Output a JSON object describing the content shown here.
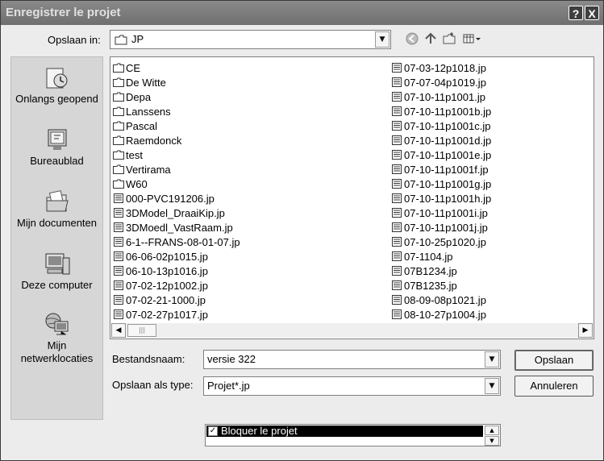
{
  "title": "Enregistrer le projet",
  "title_buttons": {
    "help": "?",
    "close": "X"
  },
  "save_in": {
    "label": "Opslaan in:",
    "value": "JP"
  },
  "places": [
    {
      "label": "Onlangs geopend",
      "icon": "recent-icon"
    },
    {
      "label": "Bureaublad",
      "icon": "desktop-icon"
    },
    {
      "label": "Mijn documenten",
      "icon": "documents-icon"
    },
    {
      "label": "Deze computer",
      "icon": "computer-icon"
    },
    {
      "label": "Mijn netwerklocaties",
      "icon": "network-icon"
    }
  ],
  "files_col1": [
    {
      "name": "CE",
      "type": "folder"
    },
    {
      "name": "De Witte",
      "type": "folder"
    },
    {
      "name": "Depa",
      "type": "folder"
    },
    {
      "name": "Lanssens",
      "type": "folder"
    },
    {
      "name": "Pascal",
      "type": "folder"
    },
    {
      "name": "Raemdonck",
      "type": "folder"
    },
    {
      "name": "test",
      "type": "folder"
    },
    {
      "name": "Vertirama",
      "type": "folder"
    },
    {
      "name": "W60",
      "type": "folder"
    },
    {
      "name": "000-PVC191206.jp",
      "type": "file"
    },
    {
      "name": "3DModel_DraaiKip.jp",
      "type": "file"
    },
    {
      "name": "3DMoedl_VastRaam.jp",
      "type": "file"
    },
    {
      "name": "6-1--FRANS-08-01-07.jp",
      "type": "file"
    },
    {
      "name": "06-06-02p1015.jp",
      "type": "file"
    },
    {
      "name": "06-10-13p1016.jp",
      "type": "file"
    },
    {
      "name": "07-02-12p1002.jp",
      "type": "file"
    },
    {
      "name": "07-02-21-1000.jp",
      "type": "file"
    },
    {
      "name": "07-02-27p1017.jp",
      "type": "file"
    }
  ],
  "files_col2": [
    {
      "name": "07-03-12p1018.jp",
      "type": "file"
    },
    {
      "name": "07-07-04p1019.jp",
      "type": "file"
    },
    {
      "name": "07-10-11p1001.jp",
      "type": "file"
    },
    {
      "name": "07-10-11p1001b.jp",
      "type": "file"
    },
    {
      "name": "07-10-11p1001c.jp",
      "type": "file"
    },
    {
      "name": "07-10-11p1001d.jp",
      "type": "file"
    },
    {
      "name": "07-10-11p1001e.jp",
      "type": "file"
    },
    {
      "name": "07-10-11p1001f.jp",
      "type": "file"
    },
    {
      "name": "07-10-11p1001g.jp",
      "type": "file"
    },
    {
      "name": "07-10-11p1001h.jp",
      "type": "file"
    },
    {
      "name": "07-10-11p1001i.jp",
      "type": "file"
    },
    {
      "name": "07-10-11p1001j.jp",
      "type": "file"
    },
    {
      "name": "07-10-25p1020.jp",
      "type": "file"
    },
    {
      "name": "07-1104.jp",
      "type": "file"
    },
    {
      "name": "07B1234.jp",
      "type": "file"
    },
    {
      "name": "07B1235.jp",
      "type": "file"
    },
    {
      "name": "08-09-08p1021.jp",
      "type": "file"
    },
    {
      "name": "08-10-27p1004.jp",
      "type": "file"
    }
  ],
  "filename": {
    "label": "Bestandsnaam:",
    "value": "versie 322"
  },
  "filetype": {
    "label": "Opslaan als type:",
    "value": "Projet*.jp"
  },
  "buttons": {
    "save": "Opslaan",
    "cancel": "Annuleren"
  },
  "lock_option": {
    "label": "Bloquer le projet",
    "checked": true
  }
}
